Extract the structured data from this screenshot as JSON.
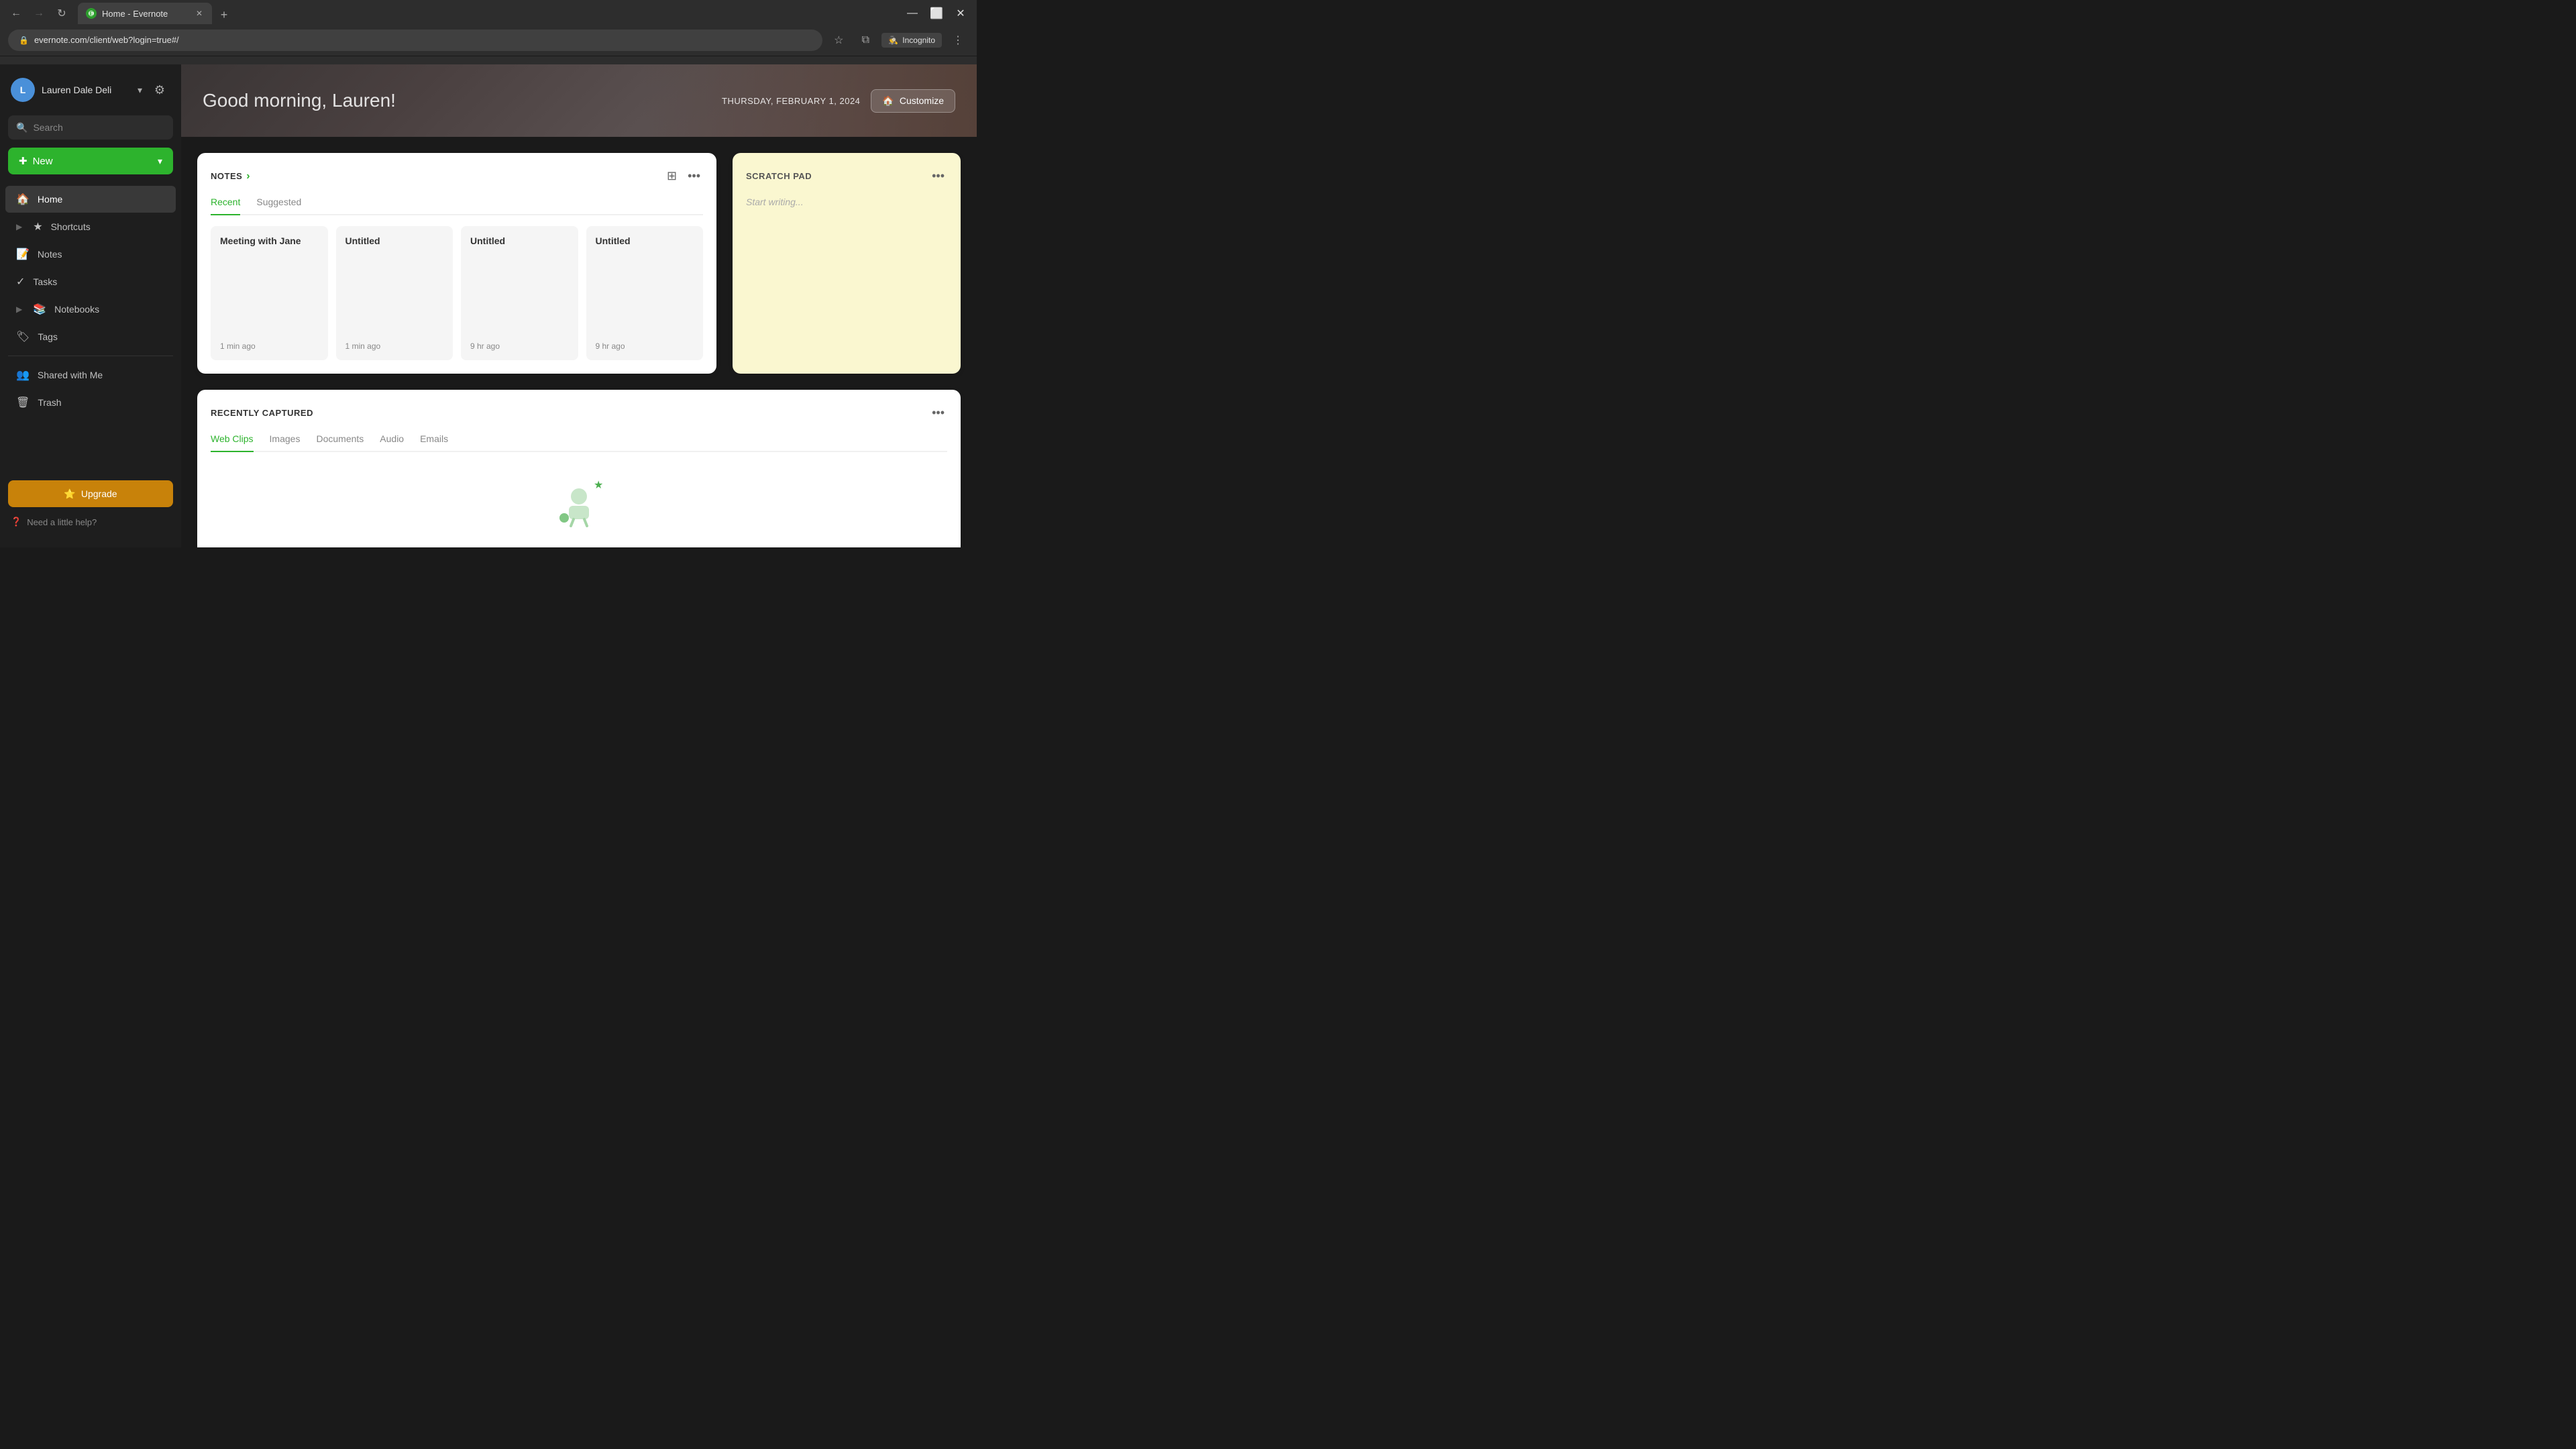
{
  "browser": {
    "tab_title": "Home - Evernote",
    "tab_new_label": "+",
    "address": "evernote.com/client/web?login=true#/",
    "nav_back": "←",
    "nav_forward": "→",
    "nav_refresh": "↻",
    "incognito_label": "Incognito",
    "bookmark_icon": "☆",
    "extensions_icon": "⊞",
    "menu_icon": "⋮"
  },
  "sidebar": {
    "user_name": "Lauren Dale Deli",
    "user_initials": "L",
    "search_placeholder": "Search",
    "new_button_label": "New",
    "nav_items": [
      {
        "id": "home",
        "label": "Home",
        "icon": "🏠",
        "active": true
      },
      {
        "id": "shortcuts",
        "label": "Shortcuts",
        "icon": "★",
        "expandable": true
      },
      {
        "id": "notes",
        "label": "Notes",
        "icon": "📝"
      },
      {
        "id": "tasks",
        "label": "Tasks",
        "icon": "✓"
      },
      {
        "id": "notebooks",
        "label": "Notebooks",
        "icon": "📚",
        "expandable": true
      },
      {
        "id": "tags",
        "label": "Tags",
        "icon": "🏷"
      },
      {
        "id": "shared",
        "label": "Shared with Me",
        "icon": "👥"
      },
      {
        "id": "trash",
        "label": "Trash",
        "icon": "🗑"
      }
    ],
    "upgrade_label": "Upgrade",
    "help_label": "Need a little help?"
  },
  "header": {
    "greeting": "Good morning, Lauren!",
    "date": "THURSDAY, FEBRUARY 1, 2024",
    "customize_label": "Customize",
    "customize_icon": "🏠"
  },
  "notes_section": {
    "title": "NOTES",
    "tabs": [
      {
        "id": "recent",
        "label": "Recent",
        "active": true
      },
      {
        "id": "suggested",
        "label": "Suggested",
        "active": false
      }
    ],
    "notes": [
      {
        "title": "Meeting with Jane",
        "time": "1 min ago"
      },
      {
        "title": "Untitled",
        "time": "1 min ago"
      },
      {
        "title": "Untitled",
        "time": "9 hr ago"
      },
      {
        "title": "Untitled",
        "time": "9 hr ago"
      }
    ]
  },
  "scratch_pad": {
    "title": "SCRATCH PAD",
    "placeholder": "Start writing..."
  },
  "recently_captured": {
    "title": "RECENTLY CAPTURED",
    "tabs": [
      {
        "id": "web-clips",
        "label": "Web Clips",
        "active": true
      },
      {
        "id": "images",
        "label": "Images",
        "active": false
      },
      {
        "id": "documents",
        "label": "Documents",
        "active": false
      },
      {
        "id": "audio",
        "label": "Audio",
        "active": false
      },
      {
        "id": "emails",
        "label": "Emails",
        "active": false
      }
    ]
  },
  "colors": {
    "green": "#2db32d",
    "dark_bg": "#1e1e1e",
    "sidebar_bg": "#1e1e1e",
    "upgrade_bg": "#c8820a",
    "scratch_bg": "#faf7d0"
  }
}
